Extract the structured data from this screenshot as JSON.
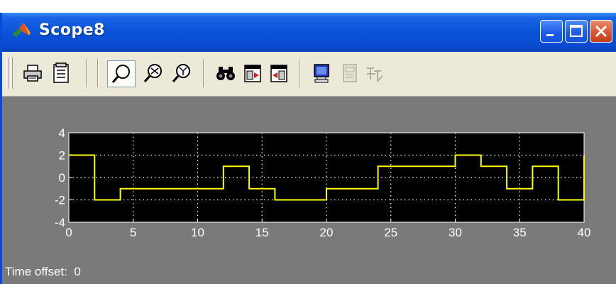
{
  "window": {
    "title": "Scope8",
    "controls": [
      "minimize",
      "maximize",
      "close"
    ]
  },
  "toolbar": {
    "buttons": [
      {
        "icon": "print-icon",
        "label": "Print"
      },
      {
        "icon": "parameters-icon",
        "label": "Parameters"
      },
      {
        "icon": "zoom-icon",
        "label": "Zoom",
        "pressed": true
      },
      {
        "icon": "zoom-x-icon",
        "label": "Zoom X-axis"
      },
      {
        "icon": "zoom-y-icon",
        "label": "Zoom Y-axis"
      },
      {
        "icon": "autoscale-icon",
        "label": "Autoscale"
      },
      {
        "icon": "save-axes-icon",
        "label": "Save axes settings"
      },
      {
        "icon": "restore-axes-icon",
        "label": "Restore saved axes settings"
      },
      {
        "icon": "floating-scope-icon",
        "label": "Floating scope"
      },
      {
        "icon": "lock-axes-icon",
        "label": "Lock axes selection",
        "disabled": true
      },
      {
        "icon": "signal-selector-icon",
        "label": "Signal selector",
        "disabled": true
      }
    ]
  },
  "status": {
    "label": "Time offset:",
    "value": "0"
  },
  "colors": {
    "plot_background": "#000000",
    "signal": "#ffff00",
    "axes_text": "#ffffff",
    "figure_background": "#7a7a7a"
  },
  "chart_data": {
    "type": "line",
    "step": true,
    "title": "",
    "xlabel": "",
    "ylabel": "",
    "xlim": [
      0,
      40
    ],
    "ylim": [
      -4,
      4
    ],
    "grid": true,
    "xticks": [
      0,
      5,
      10,
      15,
      20,
      25,
      30,
      35,
      40
    ],
    "yticks": [
      -4,
      -2,
      0,
      2,
      4
    ],
    "series": [
      {
        "x": [
          0,
          2,
          2,
          4,
          4,
          12,
          12,
          14,
          14,
          16,
          16,
          20,
          20,
          24,
          24,
          30,
          30,
          32,
          32,
          34,
          34,
          36,
          36,
          38,
          38,
          40,
          40
        ],
        "y": [
          2,
          2,
          -2,
          -2,
          -1,
          -1,
          1,
          1,
          -1,
          -1,
          -2,
          -2,
          -1,
          -1,
          1,
          1,
          2,
          2,
          1,
          1,
          -1,
          -1,
          1,
          1,
          -2,
          -2,
          2
        ]
      }
    ]
  }
}
